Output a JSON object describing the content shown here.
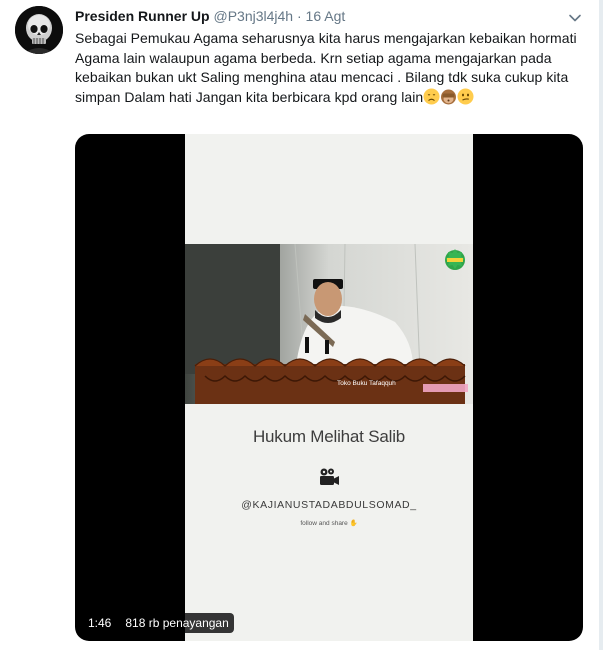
{
  "tweet": {
    "name": "Presiden Runner Up",
    "handle": "@P3nj3l4j4h",
    "separator": "·",
    "date": "16 Agt",
    "text": "Sebagai Pemukau Agama seharusnya kita harus mengajarkan kebaikan hormati Agama lain walaupun agama berbeda. Krn setiap agama mengajarkan pada kebaikan bukan ukt Saling menghina atau mencaci . Bilang tdk suka cukup kita simpan Dalam hati Jangan kita berbicara kpd orang lain"
  },
  "video": {
    "duration": "1:46",
    "views": "818 rb penayangan",
    "title": "Hukum Melihat Salib",
    "watermark_handle": "@KAJIANUSTADABDULSOMAD_",
    "follow_text": "follow and share",
    "book_label": "Toko Buku Tafaqquh"
  },
  "colors": {
    "name": "#14171a",
    "secondary": "#657786",
    "media_bg": "#000000",
    "video_frame": "#f1f2ef"
  },
  "icons": [
    "avatar-skull",
    "caret-down-icon",
    "emoji-disappointed",
    "emoji-see-no-evil-monkey",
    "emoji-confused",
    "film-camera-icon",
    "verified-badge-icon"
  ]
}
